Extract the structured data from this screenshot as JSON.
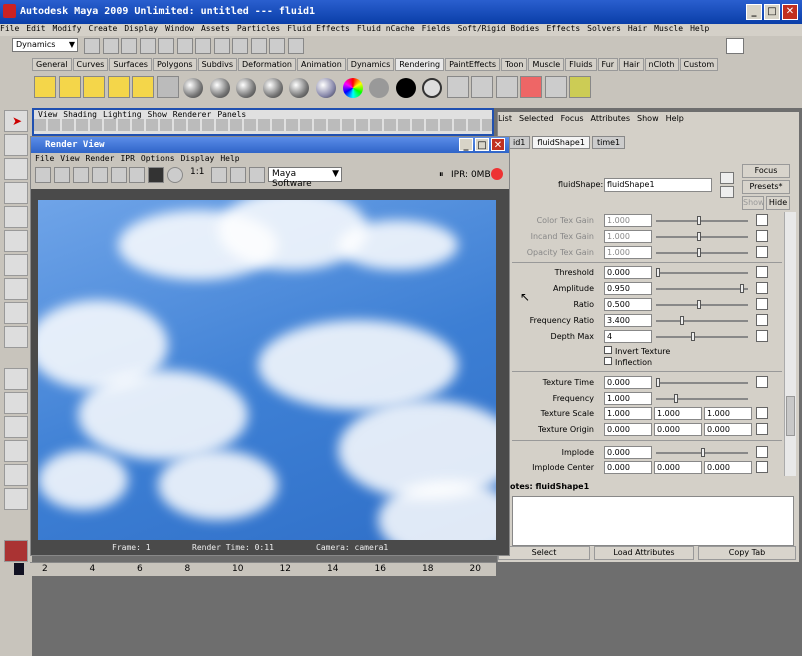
{
  "window": {
    "title": "Autodesk Maya 2009 Unlimited: untitled    ---    fluid1"
  },
  "menu": [
    "File",
    "Edit",
    "Modify",
    "Create",
    "Display",
    "Window",
    "Assets",
    "Particles",
    "Fluid Effects",
    "Fluid nCache",
    "Fields",
    "Soft/Rigid Bodies",
    "Effects",
    "Solvers",
    "Hair",
    "Muscle",
    "Help"
  ],
  "menuset": "Dynamics",
  "shelf_tabs": [
    "General",
    "Curves",
    "Surfaces",
    "Polygons",
    "Subdivs",
    "Deformation",
    "Animation",
    "Dynamics",
    "Rendering",
    "PaintEffects",
    "Toon",
    "Muscle",
    "Fluids",
    "Fur",
    "Hair",
    "nCloth",
    "Custom"
  ],
  "shelf_active": "Rendering",
  "viewport_menu": [
    "View",
    "Shading",
    "Lighting",
    "Show",
    "Renderer",
    "Panels"
  ],
  "render_view": {
    "title": "Render View",
    "menu": [
      "File",
      "View",
      "Render",
      "IPR",
      "Options",
      "Display",
      "Help"
    ],
    "ratio": "1:1",
    "renderer": "Maya Software",
    "ipr": "IPR: 0MB",
    "frame": "Frame: 1",
    "render_time": "Render Time: 0:11",
    "camera": "Camera: camera1"
  },
  "attr_editor": {
    "menu": [
      "List",
      "Selected",
      "Focus",
      "Attributes",
      "Show",
      "Help"
    ],
    "tabs": [
      "id1",
      "fluidShape1",
      "time1"
    ],
    "active_tab": "fluidShape1",
    "shape_label": "fluidShape:",
    "shape_value": "fluidShape1",
    "focus": "Focus",
    "presets": "Presets*",
    "show": "Show",
    "hide": "Hide",
    "rows1": [
      {
        "label": "Color Tex Gain",
        "value": "1.000",
        "level": 0.47
      },
      {
        "label": "Incand Tex Gain",
        "value": "1.000",
        "level": 0.47
      },
      {
        "label": "Opacity Tex Gain",
        "value": "1.000",
        "level": 0.47
      }
    ],
    "rows2": [
      {
        "label": "Threshold",
        "value": "0.000",
        "level": 0.0
      },
      {
        "label": "Amplitude",
        "value": "0.950",
        "level": 0.95
      },
      {
        "label": "Ratio",
        "value": "0.500",
        "level": 0.47
      },
      {
        "label": "Frequency Ratio",
        "value": "3.400",
        "level": 0.27
      },
      {
        "label": "Depth Max",
        "value": "4",
        "level": 0.4
      }
    ],
    "invert_texture": "Invert Texture",
    "inflection": "Inflection",
    "texture_time": {
      "label": "Texture Time",
      "value": "0.000"
    },
    "frequency": {
      "label": "Frequency",
      "value": "1.000"
    },
    "texture_scale": {
      "label": "Texture Scale",
      "v1": "1.000",
      "v2": "1.000",
      "v3": "1.000"
    },
    "texture_origin": {
      "label": "Texture Origin",
      "v1": "0.000",
      "v2": "0.000",
      "v3": "0.000"
    },
    "implode": {
      "label": "Implode",
      "value": "0.000"
    },
    "implode_center": {
      "label": "Implode Center",
      "v1": "0.000",
      "v2": "0.000",
      "v3": "0.000"
    },
    "notes": "otes: fluidShape1",
    "select": "Select",
    "load": "Load Attributes",
    "copy": "Copy Tab"
  },
  "timeline": [
    "2",
    "4",
    "6",
    "8",
    "10",
    "12",
    "14",
    "16",
    "18",
    "20"
  ]
}
